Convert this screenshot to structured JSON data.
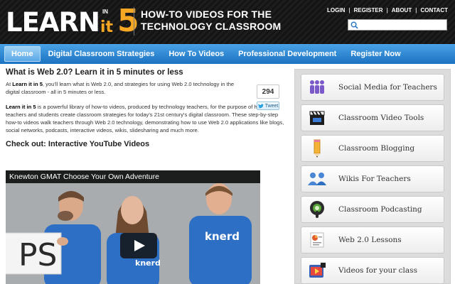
{
  "brand": {
    "learn": "LEARN",
    "it": "it",
    "in": "IN",
    "five": "5",
    "tagline": "HOW-TO VIDEOS FOR THE TECHNOLOGY CLASSROOM",
    "accent_color": "#f5a623"
  },
  "top_links": [
    "LOGIN",
    "REGISTER",
    "ABOUT",
    "CONTACT"
  ],
  "search": {
    "placeholder": "",
    "value": ""
  },
  "nav": {
    "items": [
      {
        "label": "Home",
        "active": true
      },
      {
        "label": "Digital Classroom Strategies",
        "active": false
      },
      {
        "label": "How To Videos",
        "active": false
      },
      {
        "label": "Professional Development",
        "active": false
      },
      {
        "label": "Register Now",
        "active": false
      }
    ],
    "color": "#1b72c2"
  },
  "main": {
    "title": "What is Web 2.0? Learn it in 5 minutes or less",
    "intro_pre": "At ",
    "intro_bold": "Learn it in 5",
    "intro_post": ", you'll learn what is Web 2.0, and strategies for using Web 2.0 technology in the digital classroom - all in 5 minutes or less.",
    "para2_bold": "Learn it in 5",
    "para2_post": " is a powerful library of how-to videos, produced by technology teachers, for the purpose of helping teachers and students create classroom strategies for today's 21st century's digital classroom. These step-by-step how-to videos walk teachers through Web 2.0 technology, demonstrating how to use Web 2.0 applications like blogs, social networks, podcasts, interactive videos, wikis, slidesharing and much more.",
    "share_count": "294",
    "tweet_label": "Tweet",
    "checkout": "Check out: Interactive YouTube Videos",
    "video_title": "Knewton GMAT Choose Your Own Adventure",
    "sign_text": "PS",
    "shirt_text_1": "knerd",
    "shirt_text_2": "knerd",
    "shirt_color": "#2d6fc4"
  },
  "sidebar": {
    "items": [
      {
        "label": "Social Media for Teachers",
        "icon": "people-icon"
      },
      {
        "label": "Classroom Video Tools",
        "icon": "clapperboard-icon"
      },
      {
        "label": "Classroom Blogging",
        "icon": "pencil-icon"
      },
      {
        "label": "Wikis For Teachers",
        "icon": "users-icon"
      },
      {
        "label": "Classroom Podcasting",
        "icon": "podcast-icon"
      },
      {
        "label": "Web 2.0 Lessons",
        "icon": "presentation-icon"
      },
      {
        "label": "Videos for your class",
        "icon": "movie-icon"
      }
    ]
  }
}
